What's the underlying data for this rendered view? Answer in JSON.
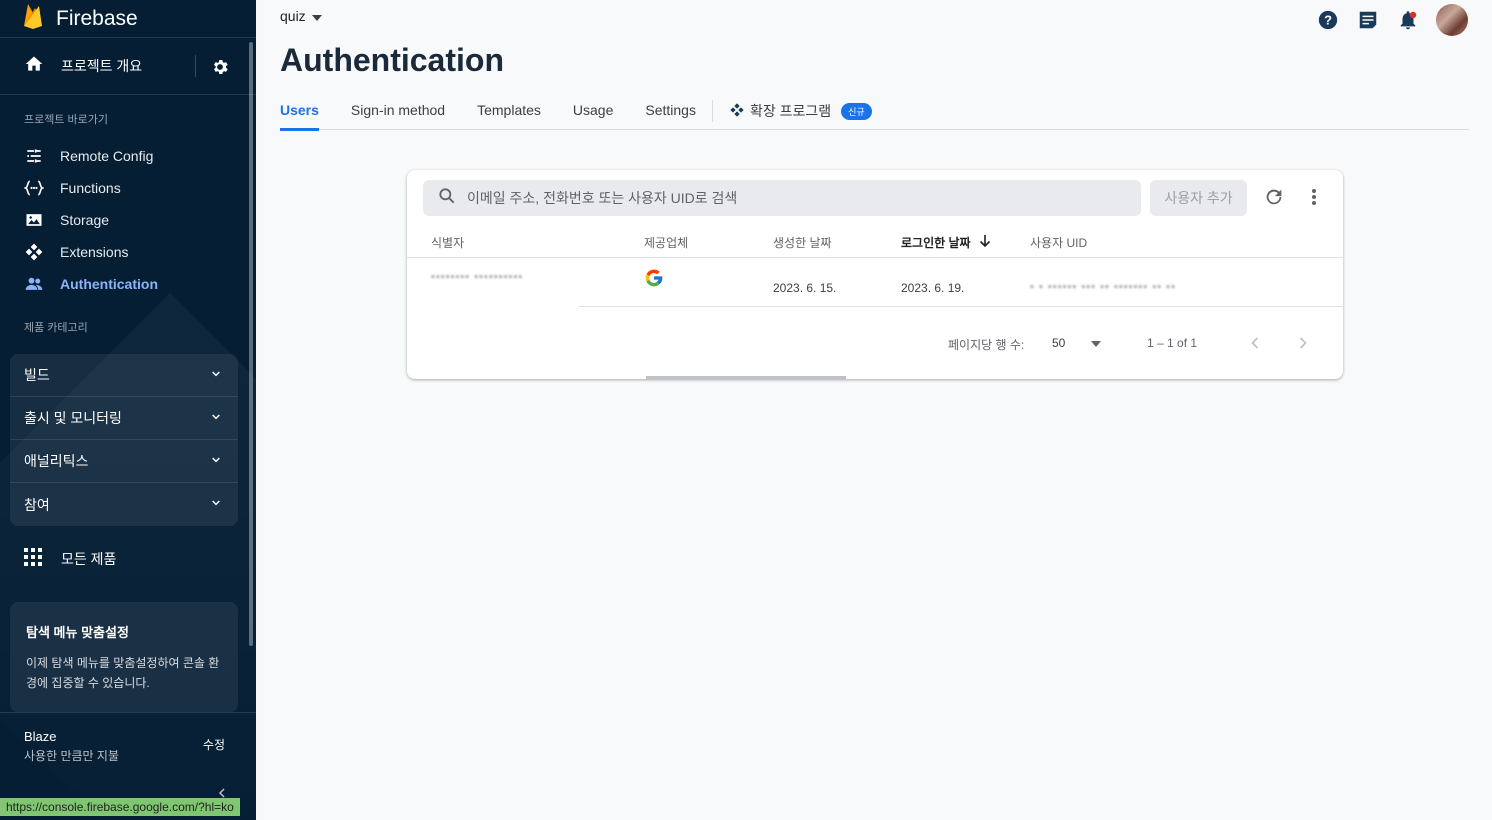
{
  "brand": {
    "name": "Firebase"
  },
  "sidebar": {
    "overview_label": "프로젝트 개요",
    "shortcuts_title": "프로젝트 바로가기",
    "shortcuts": [
      {
        "label": "Remote Config",
        "icon": "remote-config-icon"
      },
      {
        "label": "Functions",
        "icon": "functions-icon"
      },
      {
        "label": "Storage",
        "icon": "storage-icon"
      },
      {
        "label": "Extensions",
        "icon": "extensions-icon"
      },
      {
        "label": "Authentication",
        "icon": "authentication-icon",
        "active": true
      }
    ],
    "categories_title": "제품 카테고리",
    "categories": [
      "빌드",
      "출시 및 모니터링",
      "애널리틱스",
      "참여"
    ],
    "all_products_label": "모든 제품",
    "customize_card": {
      "title": "탐색 메뉴 맞춤설정",
      "description": "이제 탐색 메뉴를 맞춤설정하여 콘솔 환경에 집중할 수 있습니다."
    },
    "plan": {
      "name": "Blaze",
      "subtitle": "사용한 만큼만 지불",
      "edit_label": "수정"
    }
  },
  "status_url": "https://console.firebase.google.com/?hl=ko",
  "header": {
    "project": "quiz"
  },
  "page": {
    "title": "Authentication",
    "tabs": [
      {
        "label": "Users",
        "active": true
      },
      {
        "label": "Sign-in method"
      },
      {
        "label": "Templates"
      },
      {
        "label": "Usage"
      },
      {
        "label": "Settings"
      }
    ],
    "extension_tab": {
      "label": "확장 프로그램",
      "badge": "신규"
    }
  },
  "users_table": {
    "search_placeholder": "이메일 주소, 전화번호 또는 사용자 UID로 검색",
    "add_user_label": "사용자 추가",
    "columns": [
      "식별자",
      "제공업체",
      "생성한 날짜",
      "로그인한 날짜",
      "사용자 UID"
    ],
    "rows": [
      {
        "identifier": "▪▪▪▪▪▪▪▪ ▪▪▪▪▪▪▪▪▪▪",
        "provider": "google",
        "created": "2023. 6. 15.",
        "signed_in": "2023. 6. 19.",
        "uid": "▪ ▪  ▪▪▪▪▪▪ ▪▪▪ ▪▪ ▪▪▪▪▪▪▪ ▪▪ ▪▪"
      }
    ],
    "pagination": {
      "rows_per_page_label": "페이지당 행 수:",
      "rows_per_page": "50",
      "range": "1 – 1 of 1"
    }
  },
  "colors": {
    "sidebar_bg": "#051e34",
    "accent": "#1a73e8",
    "active_nav": "#8ab4f8",
    "firebase_yellow": "#ffca28"
  }
}
